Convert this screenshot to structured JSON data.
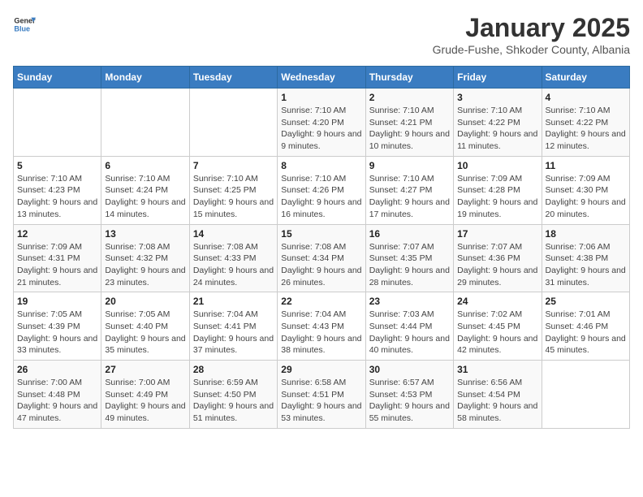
{
  "logo": {
    "general": "General",
    "blue": "Blue"
  },
  "title": "January 2025",
  "subtitle": "Grude-Fushe, Shkoder County, Albania",
  "weekdays": [
    "Sunday",
    "Monday",
    "Tuesday",
    "Wednesday",
    "Thursday",
    "Friday",
    "Saturday"
  ],
  "weeks": [
    [
      {
        "day": "",
        "info": ""
      },
      {
        "day": "",
        "info": ""
      },
      {
        "day": "",
        "info": ""
      },
      {
        "day": "1",
        "info": "Sunrise: 7:10 AM\nSunset: 4:20 PM\nDaylight: 9 hours and 9 minutes."
      },
      {
        "day": "2",
        "info": "Sunrise: 7:10 AM\nSunset: 4:21 PM\nDaylight: 9 hours and 10 minutes."
      },
      {
        "day": "3",
        "info": "Sunrise: 7:10 AM\nSunset: 4:22 PM\nDaylight: 9 hours and 11 minutes."
      },
      {
        "day": "4",
        "info": "Sunrise: 7:10 AM\nSunset: 4:22 PM\nDaylight: 9 hours and 12 minutes."
      }
    ],
    [
      {
        "day": "5",
        "info": "Sunrise: 7:10 AM\nSunset: 4:23 PM\nDaylight: 9 hours and 13 minutes."
      },
      {
        "day": "6",
        "info": "Sunrise: 7:10 AM\nSunset: 4:24 PM\nDaylight: 9 hours and 14 minutes."
      },
      {
        "day": "7",
        "info": "Sunrise: 7:10 AM\nSunset: 4:25 PM\nDaylight: 9 hours and 15 minutes."
      },
      {
        "day": "8",
        "info": "Sunrise: 7:10 AM\nSunset: 4:26 PM\nDaylight: 9 hours and 16 minutes."
      },
      {
        "day": "9",
        "info": "Sunrise: 7:10 AM\nSunset: 4:27 PM\nDaylight: 9 hours and 17 minutes."
      },
      {
        "day": "10",
        "info": "Sunrise: 7:09 AM\nSunset: 4:28 PM\nDaylight: 9 hours and 19 minutes."
      },
      {
        "day": "11",
        "info": "Sunrise: 7:09 AM\nSunset: 4:30 PM\nDaylight: 9 hours and 20 minutes."
      }
    ],
    [
      {
        "day": "12",
        "info": "Sunrise: 7:09 AM\nSunset: 4:31 PM\nDaylight: 9 hours and 21 minutes."
      },
      {
        "day": "13",
        "info": "Sunrise: 7:08 AM\nSunset: 4:32 PM\nDaylight: 9 hours and 23 minutes."
      },
      {
        "day": "14",
        "info": "Sunrise: 7:08 AM\nSunset: 4:33 PM\nDaylight: 9 hours and 24 minutes."
      },
      {
        "day": "15",
        "info": "Sunrise: 7:08 AM\nSunset: 4:34 PM\nDaylight: 9 hours and 26 minutes."
      },
      {
        "day": "16",
        "info": "Sunrise: 7:07 AM\nSunset: 4:35 PM\nDaylight: 9 hours and 28 minutes."
      },
      {
        "day": "17",
        "info": "Sunrise: 7:07 AM\nSunset: 4:36 PM\nDaylight: 9 hours and 29 minutes."
      },
      {
        "day": "18",
        "info": "Sunrise: 7:06 AM\nSunset: 4:38 PM\nDaylight: 9 hours and 31 minutes."
      }
    ],
    [
      {
        "day": "19",
        "info": "Sunrise: 7:05 AM\nSunset: 4:39 PM\nDaylight: 9 hours and 33 minutes."
      },
      {
        "day": "20",
        "info": "Sunrise: 7:05 AM\nSunset: 4:40 PM\nDaylight: 9 hours and 35 minutes."
      },
      {
        "day": "21",
        "info": "Sunrise: 7:04 AM\nSunset: 4:41 PM\nDaylight: 9 hours and 37 minutes."
      },
      {
        "day": "22",
        "info": "Sunrise: 7:04 AM\nSunset: 4:43 PM\nDaylight: 9 hours and 38 minutes."
      },
      {
        "day": "23",
        "info": "Sunrise: 7:03 AM\nSunset: 4:44 PM\nDaylight: 9 hours and 40 minutes."
      },
      {
        "day": "24",
        "info": "Sunrise: 7:02 AM\nSunset: 4:45 PM\nDaylight: 9 hours and 42 minutes."
      },
      {
        "day": "25",
        "info": "Sunrise: 7:01 AM\nSunset: 4:46 PM\nDaylight: 9 hours and 45 minutes."
      }
    ],
    [
      {
        "day": "26",
        "info": "Sunrise: 7:00 AM\nSunset: 4:48 PM\nDaylight: 9 hours and 47 minutes."
      },
      {
        "day": "27",
        "info": "Sunrise: 7:00 AM\nSunset: 4:49 PM\nDaylight: 9 hours and 49 minutes."
      },
      {
        "day": "28",
        "info": "Sunrise: 6:59 AM\nSunset: 4:50 PM\nDaylight: 9 hours and 51 minutes."
      },
      {
        "day": "29",
        "info": "Sunrise: 6:58 AM\nSunset: 4:51 PM\nDaylight: 9 hours and 53 minutes."
      },
      {
        "day": "30",
        "info": "Sunrise: 6:57 AM\nSunset: 4:53 PM\nDaylight: 9 hours and 55 minutes."
      },
      {
        "day": "31",
        "info": "Sunrise: 6:56 AM\nSunset: 4:54 PM\nDaylight: 9 hours and 58 minutes."
      },
      {
        "day": "",
        "info": ""
      }
    ]
  ]
}
